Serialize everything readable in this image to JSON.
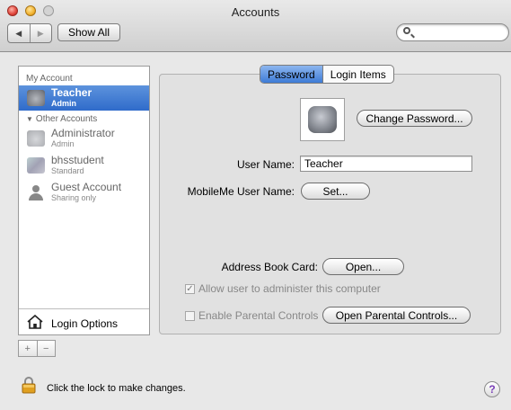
{
  "window": {
    "title": "Accounts"
  },
  "toolbar": {
    "back_label": "◀",
    "forward_label": "▶",
    "show_all_label": "Show All",
    "search_placeholder": ""
  },
  "sidebar": {
    "my_account_header": "My Account",
    "other_accounts_header": "Other Accounts",
    "accounts": [
      {
        "name": "Teacher",
        "role": "Admin"
      },
      {
        "name": "Administrator",
        "role": "Admin"
      },
      {
        "name": "bhsstudent",
        "role": "Standard"
      },
      {
        "name": "Guest Account",
        "role": "Sharing only"
      }
    ],
    "login_options_label": "Login Options",
    "add_label": "+",
    "remove_label": "−"
  },
  "tabs": {
    "password": "Password",
    "login_items": "Login Items"
  },
  "panel": {
    "change_password_label": "Change Password...",
    "user_name_label": "User Name:",
    "user_name_value": "Teacher",
    "mobileme_label": "MobileMe User Name:",
    "set_label": "Set...",
    "address_card_label": "Address Book Card:",
    "open_label": "Open...",
    "allow_admin_label": "Allow user to administer this computer",
    "parental_label": "Enable Parental Controls",
    "open_parental_label": "Open Parental Controls..."
  },
  "footer": {
    "lock_text": "Click the lock to make changes.",
    "help_label": "?"
  },
  "colors": {
    "selection": "#3a76d0",
    "tab_active": "#5b93e0"
  }
}
